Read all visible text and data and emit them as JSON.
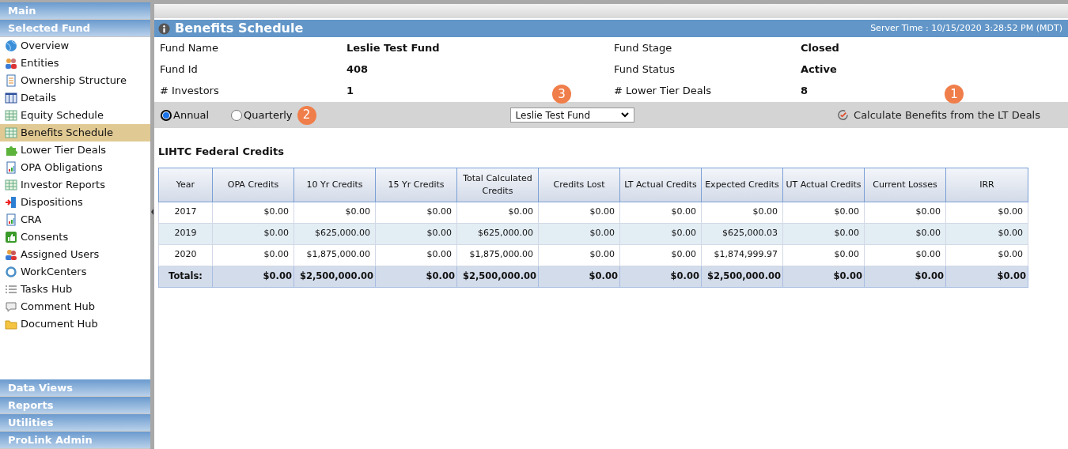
{
  "sidebar": {
    "top_sections": [
      "Main",
      "Selected Fund"
    ],
    "items": [
      {
        "label": "Overview",
        "selected": false
      },
      {
        "label": "Entities",
        "selected": false
      },
      {
        "label": "Ownership Structure",
        "selected": false
      },
      {
        "label": "Details",
        "selected": false
      },
      {
        "label": "Equity Schedule",
        "selected": false
      },
      {
        "label": "Benefits Schedule",
        "selected": true
      },
      {
        "label": "Lower Tier Deals",
        "selected": false
      },
      {
        "label": "OPA Obligations",
        "selected": false
      },
      {
        "label": "Investor Reports",
        "selected": false
      },
      {
        "label": "Dispositions",
        "selected": false
      },
      {
        "label": "CRA",
        "selected": false
      },
      {
        "label": "Consents",
        "selected": false
      },
      {
        "label": "Assigned Users",
        "selected": false
      },
      {
        "label": "WorkCenters",
        "selected": false
      },
      {
        "label": "Tasks Hub",
        "selected": false
      },
      {
        "label": "Comment Hub",
        "selected": false
      },
      {
        "label": "Document Hub",
        "selected": false
      }
    ],
    "bottom_sections": [
      "Data Views",
      "Reports",
      "Utilities",
      "ProLink Admin"
    ]
  },
  "page": {
    "title": "Benefits Schedule",
    "server_time": "Server Time : 10/15/2020 3:28:52 PM (MDT)"
  },
  "fund_info": [
    {
      "label": "Fund Name",
      "value": "Leslie Test Fund"
    },
    {
      "label": "Fund Stage",
      "value": "Closed"
    },
    {
      "label": "Fund Id",
      "value": "408"
    },
    {
      "label": "Fund Status",
      "value": "Active"
    },
    {
      "label": "# Investors",
      "value": "1"
    },
    {
      "label": "# Lower Tier Deals",
      "value": "8"
    }
  ],
  "toolbar": {
    "periods": [
      {
        "label": "Annual",
        "selected": true
      },
      {
        "label": "Quarterly",
        "selected": false
      }
    ],
    "period_badge": "2",
    "fund_select": "Leslie Test Fund",
    "fund_badge": "3",
    "calculate_button": "Calculate Benefits from the LT Deals",
    "calculate_badge": "1"
  },
  "table": {
    "title": "LIHTC Federal Credits",
    "columns": [
      "Year",
      "OPA Credits",
      "10 Yr Credits",
      "15 Yr Credits",
      "Total Calculated Credits",
      "Credits Lost",
      "LT Actual Credits",
      "Expected Credits",
      "UT Actual Credits",
      "Current Losses",
      "IRR"
    ],
    "rows": [
      [
        "2017",
        "$0.00",
        "$0.00",
        "$0.00",
        "$0.00",
        "$0.00",
        "$0.00",
        "$0.00",
        "$0.00",
        "$0.00",
        "$0.00"
      ],
      [
        "2019",
        "$0.00",
        "$625,000.00",
        "$0.00",
        "$625,000.00",
        "$0.00",
        "$0.00",
        "$625,000.03",
        "$0.00",
        "$0.00",
        "$0.00"
      ],
      [
        "2020",
        "$0.00",
        "$1,875,000.00",
        "$0.00",
        "$1,875,000.00",
        "$0.00",
        "$0.00",
        "$1,874,999.97",
        "$0.00",
        "$0.00",
        "$0.00"
      ]
    ],
    "totals": [
      "Totals:",
      "$0.00",
      "$2,500,000.00",
      "$0.00",
      "$2,500,000.00",
      "$0.00",
      "$0.00",
      "$2,500,000.00",
      "$0.00",
      "$0.00",
      "$0.00"
    ]
  }
}
